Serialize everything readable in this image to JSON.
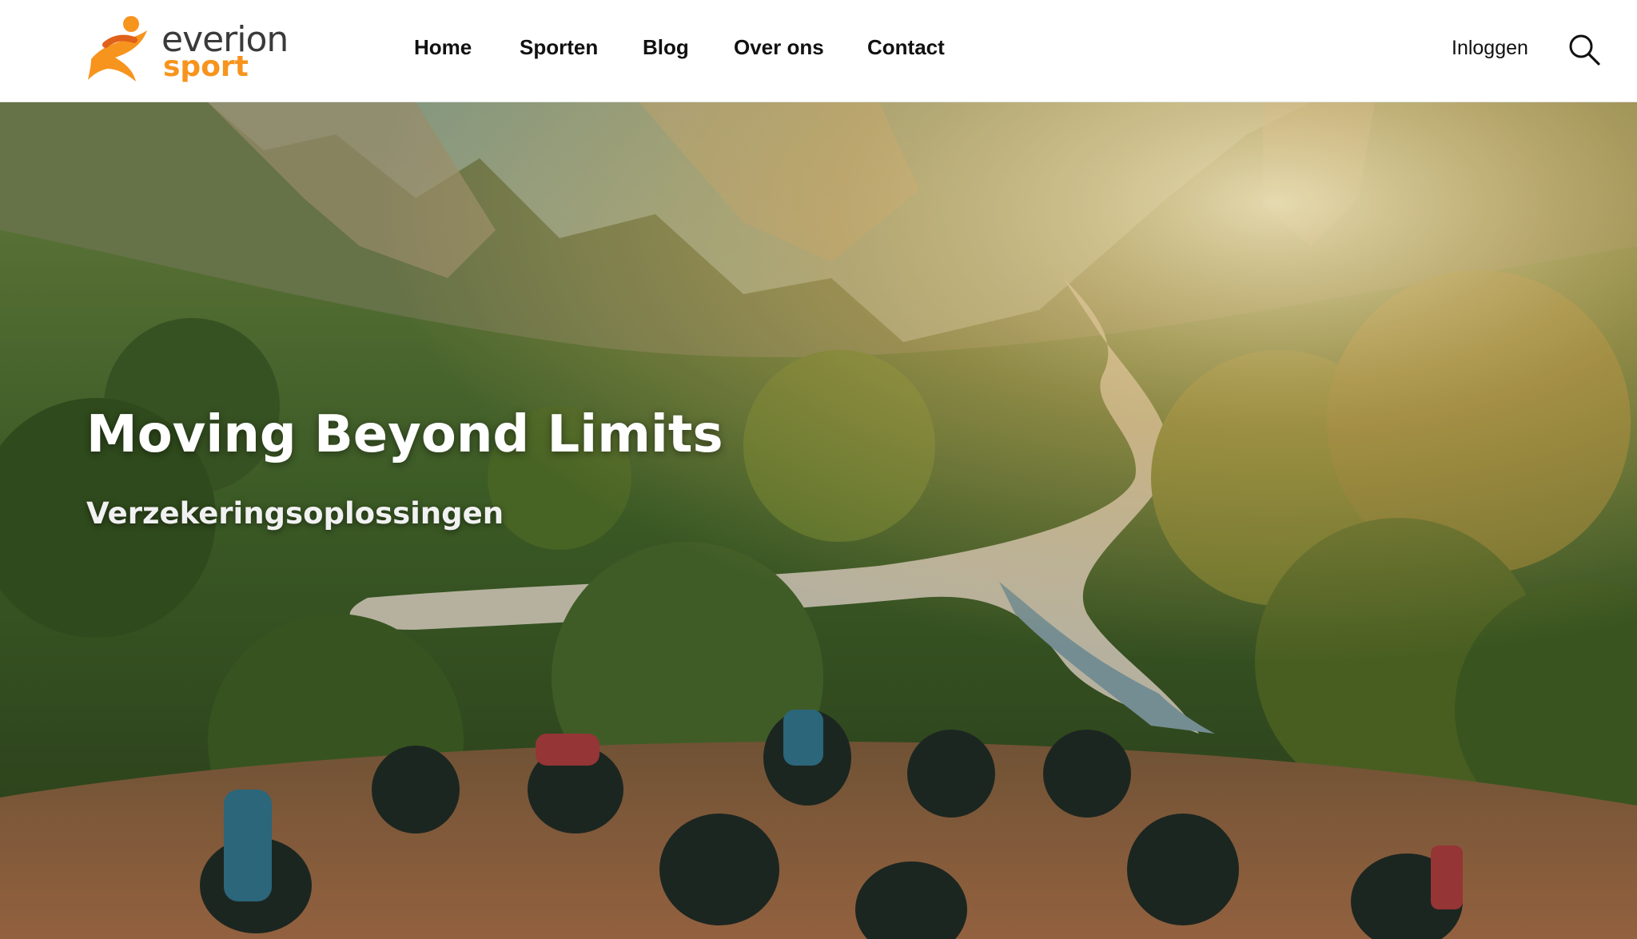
{
  "brand": {
    "name_line1": "everion",
    "name_line2": "sport",
    "colors": {
      "orange": "#f7941d",
      "dark": "#3a3a3a"
    }
  },
  "nav": {
    "items": [
      {
        "label": "Home"
      },
      {
        "label": "Sporten"
      },
      {
        "label": "Blog"
      },
      {
        "label": "Over ons"
      },
      {
        "label": "Contact"
      }
    ],
    "login_label": "Inloggen",
    "search_icon": "search-icon"
  },
  "hero": {
    "title": "Moving Beyond Limits",
    "subtitle": "Verzekeringsoplossingen",
    "image": "hero-photo-wheelchair-hikers-valley"
  }
}
